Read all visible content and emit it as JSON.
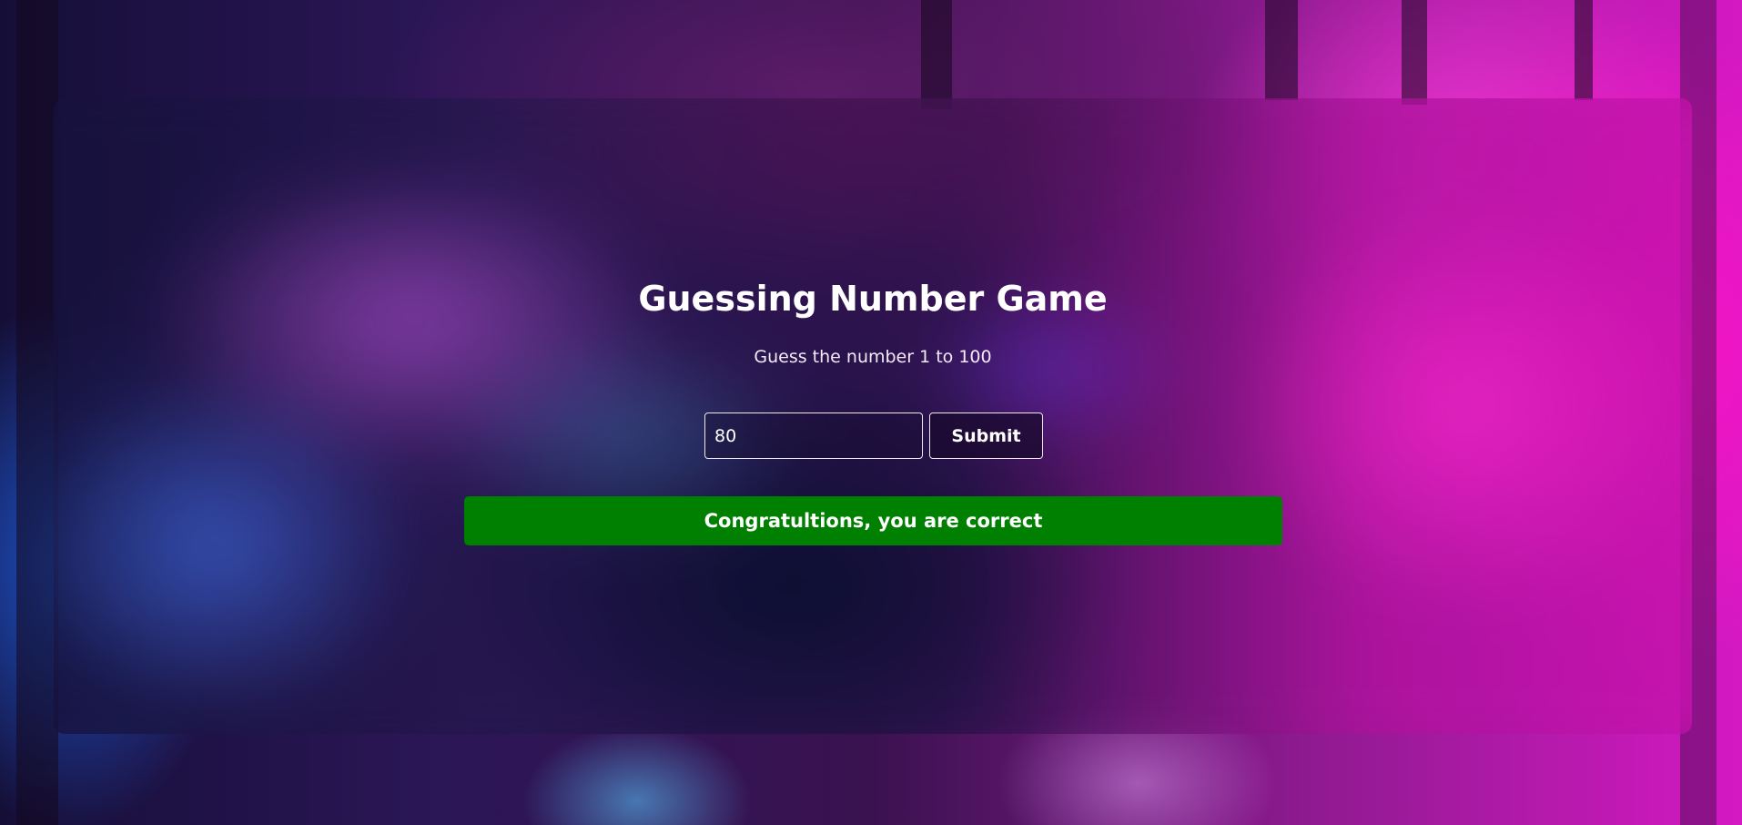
{
  "game": {
    "title": "Guessing Number Game",
    "subtitle": "Guess the number 1 to 100",
    "input_value": "80",
    "submit_label": "Submit",
    "result_message": "Congratultions, you are correct"
  },
  "colors": {
    "result_success": "#008000",
    "text": "#ffffff",
    "background_accent": "#d419c2"
  }
}
